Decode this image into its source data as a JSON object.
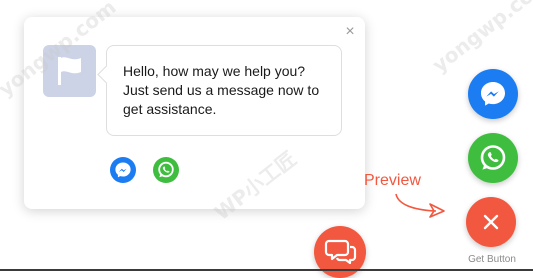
{
  "popup": {
    "close_glyph": "×",
    "avatar_icon": "flag-icon",
    "message_lines": [
      "Hello, how may we help you?",
      "Just send us a message now to",
      "get assistance."
    ],
    "channels": [
      {
        "name": "Messenger",
        "icon": "messenger-icon",
        "color": "#1c7cf2"
      },
      {
        "name": "WhatsApp",
        "icon": "whatsapp-icon",
        "color": "#3fbd3f"
      }
    ]
  },
  "floating_buttons": {
    "messenger": {
      "icon": "messenger-icon",
      "color": "#1c7cf2"
    },
    "whatsapp": {
      "icon": "whatsapp-icon",
      "color": "#3fbd3f"
    },
    "close": {
      "icon": "close-icon",
      "color": "#f2573f"
    },
    "chat": {
      "icon": "chat-bubbles-icon",
      "color": "#f2573f"
    }
  },
  "get_button_label": "Get Button",
  "preview_label": "Preview",
  "watermarks": [
    "WP小工匠",
    "yongwp.com"
  ]
}
